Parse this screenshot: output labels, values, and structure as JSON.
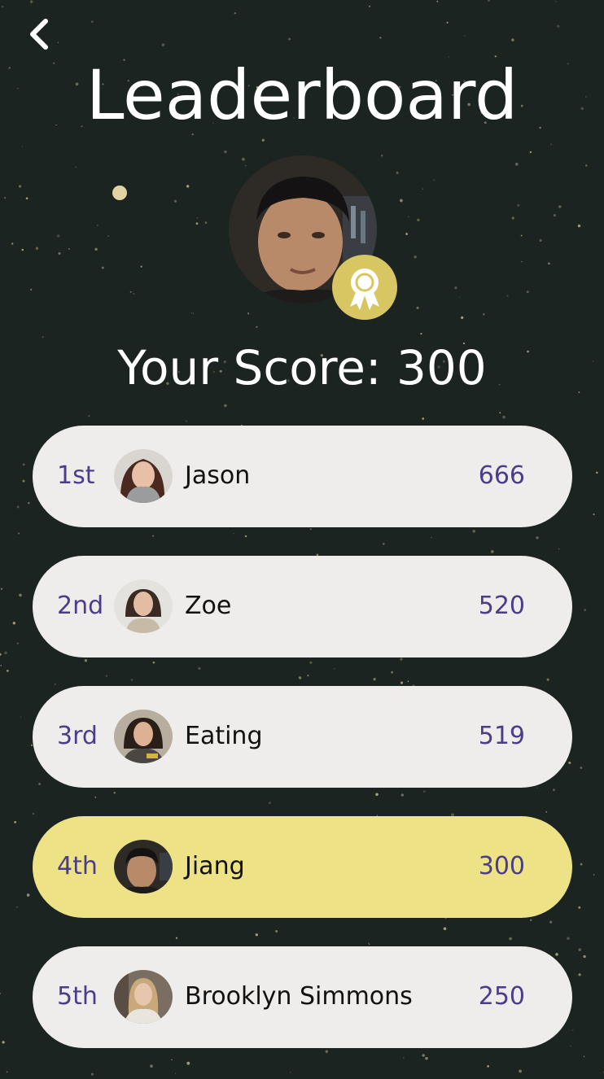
{
  "header": {
    "title": "Leaderboard",
    "back_icon": "chevron-left-icon"
  },
  "profile": {
    "score_text": "Your Score: 300",
    "badge_icon": "award-ribbon-icon",
    "badge_color": "#d7c662"
  },
  "colors": {
    "background": "#1b2421",
    "row_background": "#efedeb",
    "current_row_background": "#ede285",
    "rank_and_score_text": "#4a3d8a"
  },
  "leaderboard": [
    {
      "rank": "1st",
      "name": "Jason",
      "score": "666",
      "current": false
    },
    {
      "rank": "2nd",
      "name": "Zoe",
      "score": "520",
      "current": false
    },
    {
      "rank": "3rd",
      "name": "Eating",
      "score": "519",
      "current": false
    },
    {
      "rank": "4th",
      "name": "Jiang",
      "score": "300",
      "current": true
    },
    {
      "rank": "5th",
      "name": "Brooklyn Simmons",
      "score": "250",
      "current": false
    }
  ]
}
